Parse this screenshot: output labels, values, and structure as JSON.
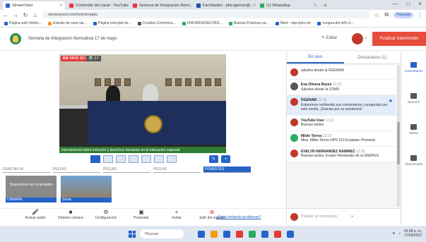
{
  "browser": {
    "tabs": [
      {
        "label": "StreamYard",
        "color": "#2563c9",
        "active": true
      },
      {
        "label": "Contenido del canal - YouTube",
        "color": "#e53935",
        "active": false
      },
      {
        "label": "Semana de Integración Norm...",
        "color": "#e53935",
        "active": false
      },
      {
        "label": "Facilidades - pfar.tgemsn@...",
        "color": "#1a4fa0",
        "active": false
      },
      {
        "label": "(1) WhatsApp",
        "color": "#27ae60",
        "active": false
      }
    ],
    "url": "streamyard.com/hsm3cnjaku",
    "profile_label": "Pausada",
    "bookmarks": [
      {
        "label": "Página web Verten...",
        "color": "#2563c9"
      },
      {
        "label": "Estudio de caso sar...",
        "color": "#f39c12"
      },
      {
        "label": "Página principal de...",
        "color": "#2563c9"
      },
      {
        "label": "Creative Commons...",
        "color": "#555555"
      },
      {
        "label": "UNIVERSIDAD PED...",
        "color": "#27ae60"
      },
      {
        "label": "Buenas Prácticas pa...",
        "color": "#27ae60"
      },
      {
        "label": "Meet - ekp-bykv-xfc",
        "color": "#2563c9"
      },
      {
        "label": "Lengua del niño d...",
        "color": "#2563c9"
      }
    ]
  },
  "header": {
    "event_title": "Semana de Integración Normalista 17 de mayo",
    "edit_label": "Editar",
    "finish_label": "Finalizar transmisión"
  },
  "stage": {
    "live_badge": "EN VIVO 22:25",
    "viewers": "17",
    "ticker": "Internacional sobre inclusión y derechos humanos en la educación especial",
    "slots": [
      "GUACHELIA",
      "PEZLAS",
      "PEZLAS",
      "PEZLAS",
      "PONENTES"
    ],
    "tiles": [
      {
        "bar": "CAMARA",
        "text": "Dispositivos no conectados"
      },
      {
        "bar": "Sonia",
        "text": ""
      }
    ]
  },
  "toolbar": {
    "buttons": [
      {
        "label": "Activar audio",
        "icon": "mic-off-icon",
        "glyph": "🎤"
      },
      {
        "label": "Detener cámara",
        "icon": "camera-icon",
        "glyph": "■"
      },
      {
        "label": "Configuración",
        "icon": "gear-icon",
        "glyph": "⚙"
      },
      {
        "label": "Presentar",
        "icon": "present-icon",
        "glyph": "▣"
      },
      {
        "label": "Invitar",
        "icon": "invite-icon",
        "glyph": "+"
      },
      {
        "label": "Salir del estudio",
        "icon": "exit-icon",
        "glyph": "⊗"
      }
    ],
    "help_link": "¿Estás teniendo problemas?"
  },
  "comments": {
    "tabs": [
      "En vivo",
      "Destacados (1)"
    ],
    "items": [
      {
        "name": "",
        "time": "",
        "text": "saludos desde la DGENAM",
        "color": "#c0392b",
        "highlight": false,
        "star": false
      },
      {
        "name": "Eva Olivera Reyes",
        "time": "12:15",
        "text": "Saludos desde la CDMX",
        "color": "#555555",
        "highlight": false,
        "star": false
      },
      {
        "name": "DGENAM",
        "time": "12:16",
        "text": "Estaremos recibiendo sus comentarios y preguntas por este medio. ¡Gracias por su asistencia!",
        "color": "#c0392b",
        "highlight": true,
        "star": true
      },
      {
        "name": "YouTube User",
        "time": "12:21",
        "text": "Buenas tardes",
        "color": "#c0392b",
        "highlight": false,
        "star": false
      },
      {
        "name": "Mildo Torres",
        "time": "12:22",
        "text": "Mtra. Mildo Torres UPN 153 Ecatepec Presente",
        "color": "#27ae60",
        "highlight": false,
        "star": false
      },
      {
        "name": "EVELYN HERNANDEZ RAMIREZ",
        "time": "12:25",
        "text": "Buenas tardes, Evelyn Hernández de la ENEPEG",
        "color": "#c0392b",
        "highlight": false,
        "star": false
      }
    ],
    "input_placeholder": "Publicar un comentario"
  },
  "right_sidebar": [
    {
      "label": "Comentarios",
      "icon": "chat-icon",
      "active": true
    },
    {
      "label": "Banners",
      "icon": "banner-icon",
      "active": false
    },
    {
      "label": "Marca",
      "icon": "brand-icon",
      "active": false
    },
    {
      "label": "Chat privado",
      "icon": "private-chat-icon",
      "active": false
    }
  ],
  "taskbar": {
    "search_label": "Buscar",
    "time": "00:38 p. m.",
    "date": "17/05/2022",
    "apps": [
      "#2563c9",
      "#f39c12",
      "#2563c9",
      "#e53935",
      "#27ae60",
      "#2563c9",
      "#e53935",
      "#2563c9"
    ]
  }
}
